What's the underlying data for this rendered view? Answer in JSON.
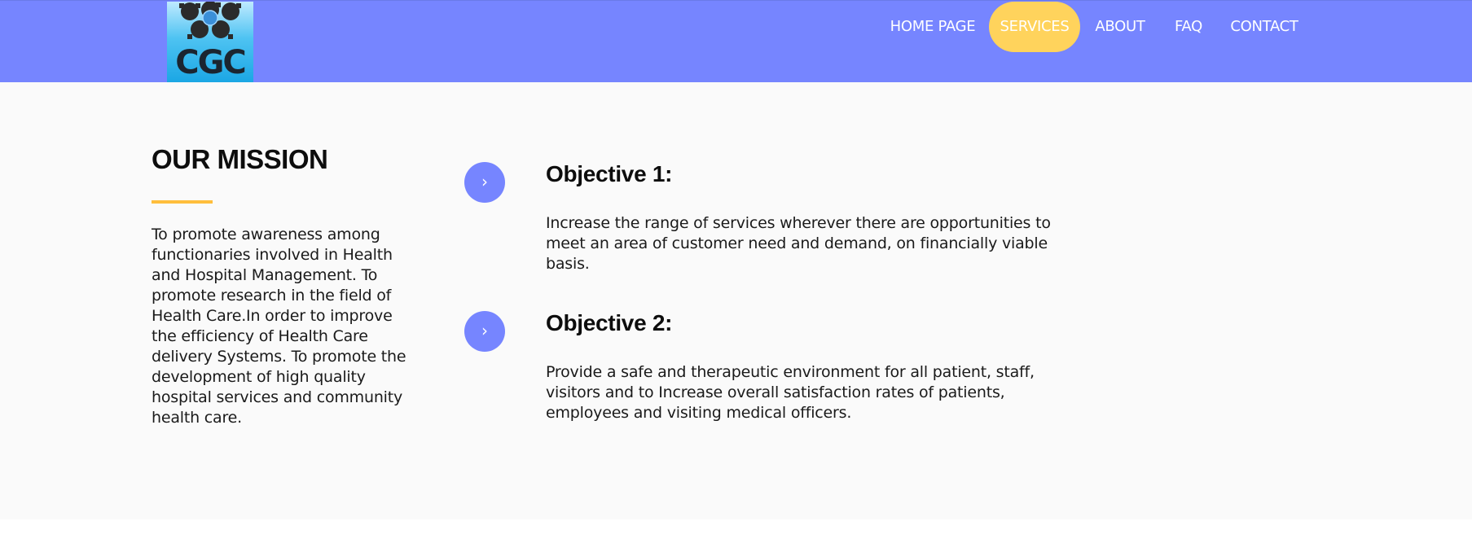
{
  "header": {
    "logo_text": "CGC",
    "nav": [
      {
        "label": "HOME PAGE",
        "active": false
      },
      {
        "label": "SERVICES",
        "active": true
      },
      {
        "label": "ABOUT",
        "active": false
      },
      {
        "label": "FAQ",
        "active": false
      },
      {
        "label": "CONTACT",
        "active": false
      }
    ]
  },
  "mission": {
    "title": "OUR MISSION",
    "text": "To promote awareness among functionaries involved in Health and Hospital Management. To promote research in the field of Health Care.In order to improve the efficiency of Health Care delivery Systems. To promote the development of high quality hospital services and community health care."
  },
  "objectives": [
    {
      "icon": "chevron-right-icon",
      "title": "Objective 1:",
      "text": "Increase the range of services wherever there are opportunities to meet an area of customer need and demand, on financially viable basis."
    },
    {
      "icon": "chevron-right-icon",
      "title": "Objective 2:",
      "text": "Provide a safe and therapeutic environment for all patient, staff, visitors and to Increase overall satisfaction rates of patients, employees and visiting medical officers."
    }
  ],
  "colors": {
    "header_bg": "#7685ff",
    "active_nav": "#ffd35c",
    "accent_rule": "#ffbe3c",
    "circle": "#7685ff"
  }
}
